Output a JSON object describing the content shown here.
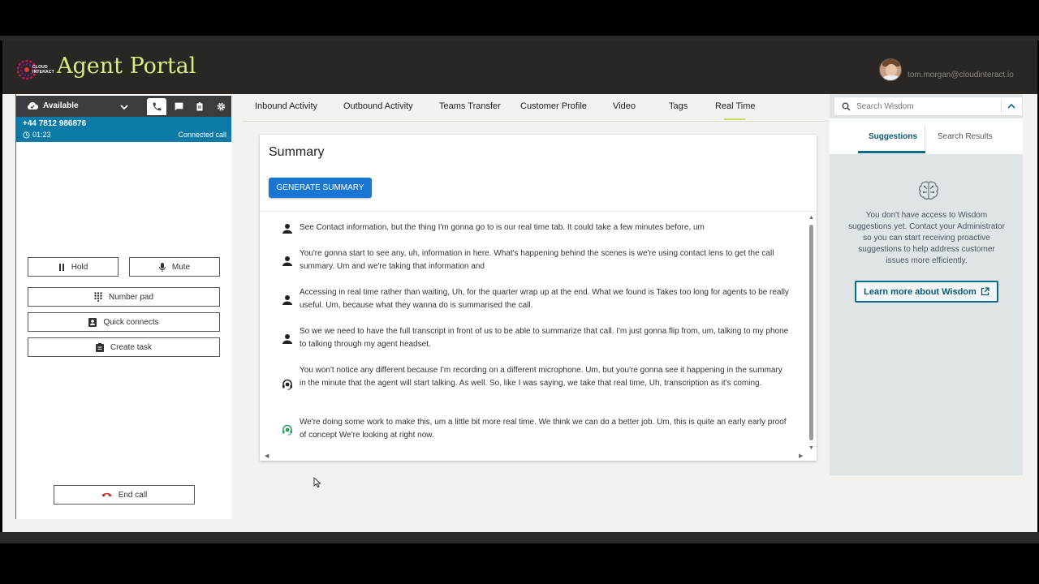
{
  "header": {
    "logo_text_line1": "CLOUD",
    "logo_text_line2": "INTERACT",
    "app_title": "Agent Portal",
    "user_email": "tom.morgan@cloudinteract.io"
  },
  "ccp": {
    "status": "Available",
    "call": {
      "number": "+44 7812 986876",
      "timer": "01:23",
      "status": "Connected call"
    },
    "buttons": {
      "hold": "Hold",
      "mute": "Mute",
      "number_pad": "Number pad",
      "quick_connects": "Quick connects",
      "create_task": "Create task",
      "end_call": "End call"
    }
  },
  "tabs": [
    {
      "label": "Inbound Activity"
    },
    {
      "label": "Outbound Activity"
    },
    {
      "label": "Teams Transfer"
    },
    {
      "label": "Customer Profile"
    },
    {
      "label": "Video"
    },
    {
      "label": "Tags"
    },
    {
      "label": "Real Time"
    }
  ],
  "summary": {
    "title": "Summary",
    "generate_button": "GENERATE SUMMARY",
    "transcript": [
      {
        "speaker": "customer",
        "text": "See Contact information, but the thing I'm gonna go to is our real time tab. It could take a few minutes before, um"
      },
      {
        "speaker": "customer",
        "text": "You're gonna start to see any, uh, information in here. What's happening behind the scenes is we're using contact lens to get the call summary. Um and we're taking that information and"
      },
      {
        "speaker": "customer",
        "text": "Accessing in real time rather than waiting, Uh, for the quarter wrap up at the end. What we found is Takes too long for agents to be really useful. Um, because what they wanna do is summarised the call."
      },
      {
        "speaker": "customer",
        "text": "So we we need to have the full transcript in front of us to be able to summarize that call. I'm just gonna flip from, um, talking to my phone to talking through my agent headset."
      },
      {
        "speaker": "agent",
        "text": "You won't notice any different because I'm recording on a different microphone. Um, but you're gonna see it happening in the summary in the minute that the agent will start talking. As well. So, like I was saying, we take that real time, Uh, transcription as it's coming."
      },
      {
        "speaker": "agent-green",
        "text": "We're doing some work to make this, um a little bit more real time. We think we can do a better job. Um, this is quite an early early proof of concept We're looking at right now."
      }
    ]
  },
  "wisdom": {
    "search_placeholder": "Search Wisdom",
    "tabs": {
      "suggestions": "Suggestions",
      "search_results": "Search Results"
    },
    "message": "You don't have access to Wisdom suggestions yet. Contact your Administrator so you can start receiving proactive suggestions to help address customer issues more efficiently.",
    "learn_more": "Learn more about Wisdom"
  },
  "colors": {
    "header_bg": "#2a2623",
    "title_green": "#d9ee7e",
    "call_bar": "#0b7aa6",
    "primary_button": "#1976d2",
    "wisdom_accent": "#0b6b8a",
    "agent_icon_green": "#2e9e5b"
  }
}
